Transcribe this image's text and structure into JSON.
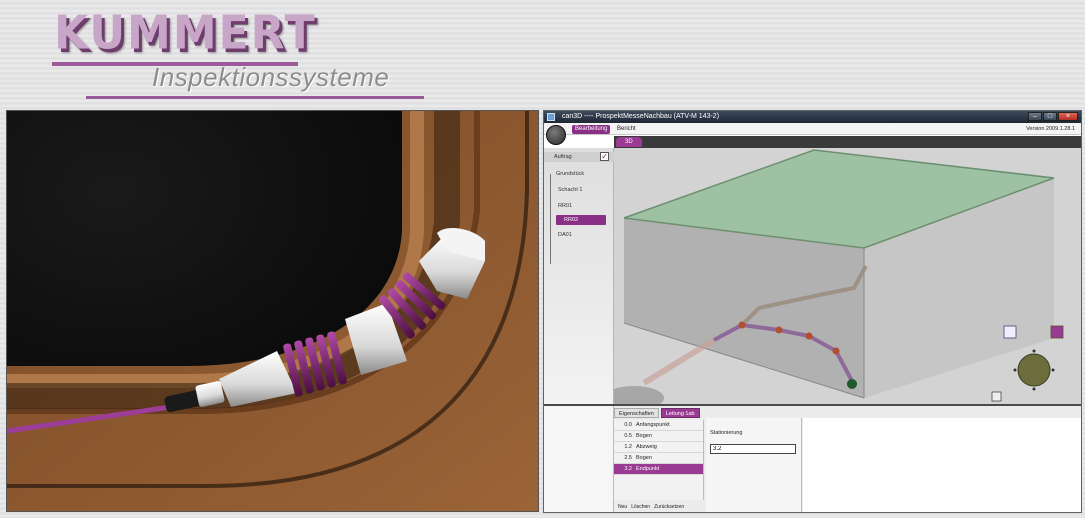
{
  "logo": {
    "brand": "KUMMERT",
    "tagline": "Inspektionssysteme"
  },
  "window": {
    "title": "can3D ---- ProspektMesseNachbau (ATV-M 143-2)",
    "version": "Version 2009.1.28.1",
    "ribbon_tabs": [
      "Bearbeitung",
      "Bericht"
    ],
    "active_ribbon_tab": 0,
    "view_tab": "3D"
  },
  "tree": {
    "header": "Auftrag",
    "items": [
      "Grundstück",
      "Schacht 1",
      "RR01",
      "RR02",
      "DA01"
    ],
    "selected_index": 3
  },
  "properties": {
    "tabs": [
      "Eigenschaften",
      "Leitung 1ab"
    ],
    "active_tab": 1,
    "list": [
      {
        "num": "0.0",
        "label": "Anfangspunkt"
      },
      {
        "num": "0.5",
        "label": "Bogen"
      },
      {
        "num": "1.2",
        "label": "Abzweig"
      },
      {
        "num": "2.5",
        "label": "Bogen"
      },
      {
        "num": "3.2",
        "label": "Endpunkt"
      }
    ],
    "selected_index": 4,
    "buttons": [
      "Neu",
      "Löschen",
      "Zurücksetzen"
    ],
    "field_label": "Stationierung",
    "field_value": "3.2"
  },
  "colors": {
    "accent": "#9a3b93",
    "logo_purple": "#c8a6c8",
    "pipe_brown": "#8a5530",
    "box_green": "#7fb08a"
  }
}
